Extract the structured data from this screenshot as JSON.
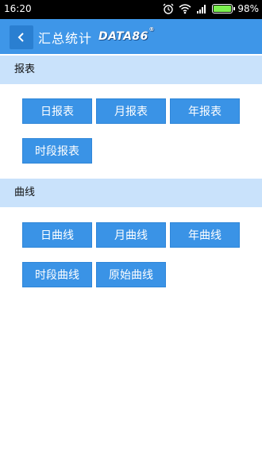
{
  "status_bar": {
    "time": "16:20",
    "battery": "98%"
  },
  "header": {
    "title": "汇总统计",
    "logo": "DATA86"
  },
  "sections": {
    "reports": {
      "title": "报表",
      "buttons": [
        "日报表",
        "月报表",
        "年报表",
        "时段报表"
      ]
    },
    "curves": {
      "title": "曲线",
      "buttons": [
        "日曲线",
        "月曲线",
        "年曲线",
        "时段曲线",
        "原始曲线"
      ]
    }
  },
  "colors": {
    "app_bar": "#3e96e8",
    "section_header": "#c9e2fb",
    "button": "#3a93e6"
  }
}
